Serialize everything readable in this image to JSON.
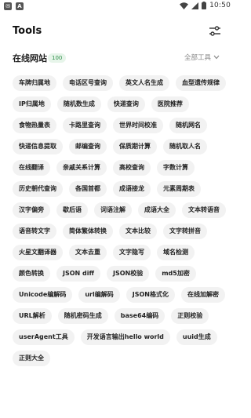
{
  "status_bar": {
    "time": "10:50",
    "left_icons": [
      "notification-icon",
      "app-icon"
    ],
    "right_icons": [
      "wifi-icon",
      "signal-icon",
      "battery-icon"
    ]
  },
  "header": {
    "title": "Tools",
    "settings_icon": "sliders-icon"
  },
  "section": {
    "title": "在线网站",
    "count": "100",
    "filter_label": "全部工具",
    "filter_icon": "chevron-down-icon"
  },
  "tools": [
    "车牌归属地",
    "电话区号查询",
    "英文人名生成",
    "血型遗传规律",
    "IP归属地",
    "随机数生成",
    "快递查询",
    "医院推荐",
    "食物热量表",
    "卡路里查询",
    "世界时间校准",
    "随机网名",
    "快递信息提取",
    "邮编查询",
    "保质期计算",
    "随机取人名",
    "在线翻译",
    "亲戚关系计算",
    "高校查询",
    "字数计算",
    "历史朝代查询",
    "各国首都",
    "成语接龙",
    "元素周期表",
    "汉字偏旁",
    "歇后语",
    "词语注解",
    "成语大全",
    "文本转语音",
    "语音转文字",
    "简体繁体转换",
    "文本比较",
    "文字转拼音",
    "火星文翻译器",
    "文本去重",
    "文字隐写",
    "域名检测",
    "颜色转换",
    "JSON diff",
    "JSON校验",
    "md5加密",
    "Unicode编解码",
    "url编解码",
    "JSON格式化",
    "在线加解密",
    "URL解析",
    "随机密码生成",
    "base64编码",
    "正则校验",
    "userAgent工具",
    "开发语言输出hello world",
    "uuid生成",
    "正则大全"
  ],
  "colors": {
    "chip_bg": "#f2f2f2",
    "badge_bg": "#e7f5ea",
    "badge_text": "#2f8f4a"
  }
}
